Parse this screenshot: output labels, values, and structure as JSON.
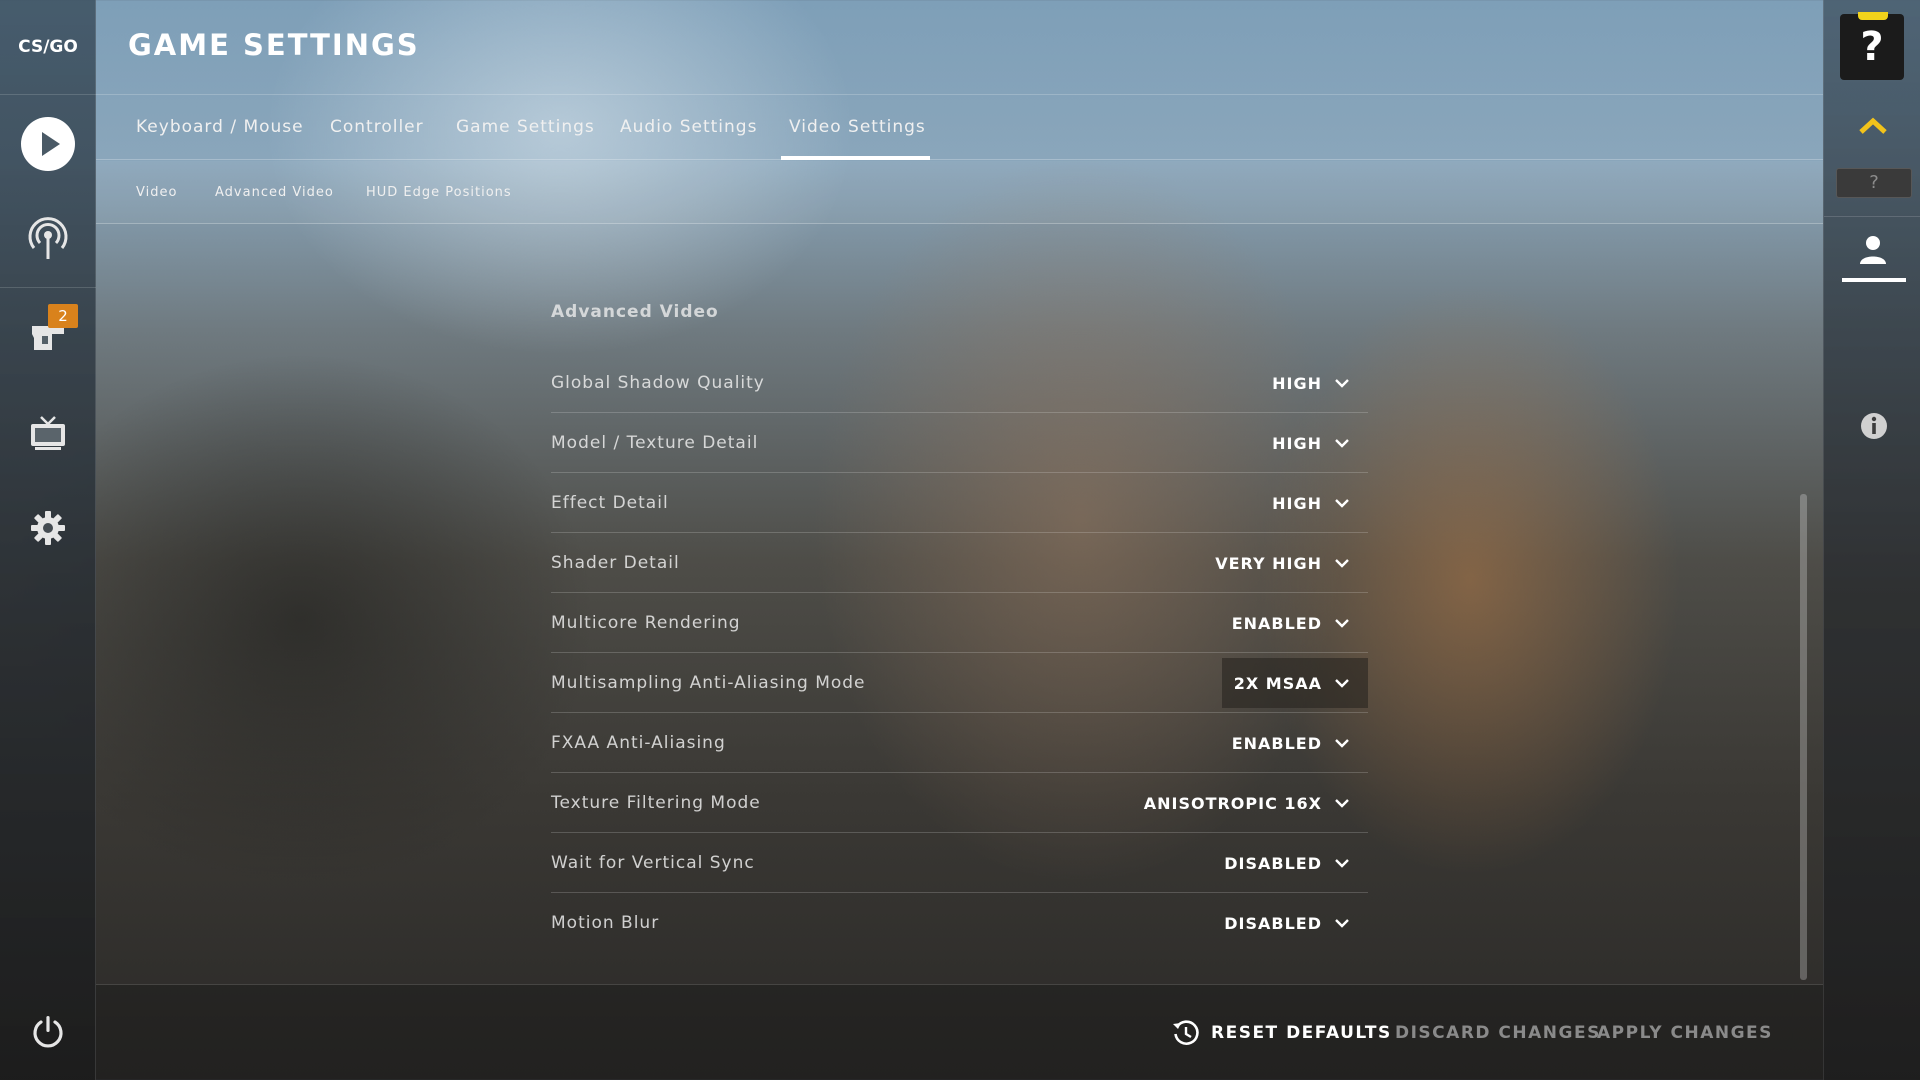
{
  "app": {
    "logo_text": "CS/GO"
  },
  "leftnav": {
    "items": [
      {
        "name": "play",
        "icon": "play-icon"
      },
      {
        "name": "watch",
        "icon": "broadcast-icon"
      },
      {
        "name": "inventory",
        "icon": "inventory-icon",
        "badge": "2"
      },
      {
        "name": "tv",
        "icon": "tv-icon"
      },
      {
        "name": "settings",
        "icon": "gear-icon"
      }
    ],
    "power_icon": "power-icon"
  },
  "header": {
    "title": "GAME SETTINGS"
  },
  "tabs": [
    {
      "label": "Keyboard / Mouse",
      "active": false
    },
    {
      "label": "Controller",
      "active": false
    },
    {
      "label": "Game Settings",
      "active": false
    },
    {
      "label": "Audio Settings",
      "active": false
    },
    {
      "label": "Video Settings",
      "active": true
    }
  ],
  "subtabs": [
    {
      "label": "Video"
    },
    {
      "label": "Advanced Video"
    },
    {
      "label": "HUD Edge Positions"
    }
  ],
  "section": {
    "title": "Advanced Video",
    "rows": [
      {
        "label": "Global Shadow Quality",
        "value": "HIGH"
      },
      {
        "label": "Model / Texture Detail",
        "value": "HIGH"
      },
      {
        "label": "Effect Detail",
        "value": "HIGH"
      },
      {
        "label": "Shader Detail",
        "value": "VERY HIGH"
      },
      {
        "label": "Multicore Rendering",
        "value": "ENABLED"
      },
      {
        "label": "Multisampling Anti-Aliasing Mode",
        "value": "2X MSAA",
        "highlight": true
      },
      {
        "label": "FXAA Anti-Aliasing",
        "value": "ENABLED"
      },
      {
        "label": "Texture Filtering Mode",
        "value": "ANISOTROPIC 16X"
      },
      {
        "label": "Wait for Vertical Sync",
        "value": "DISABLED"
      },
      {
        "label": "Motion Blur",
        "value": "DISABLED"
      }
    ]
  },
  "footer": {
    "reset_label": "RESET DEFAULTS",
    "discard_label": "DISCARD CHANGES",
    "apply_label": "APPLY CHANGES"
  },
  "rightbar": {
    "help_label": "?",
    "small_help_label": "?"
  },
  "colors": {
    "badge": "#d9821c",
    "help_accent": "#f2d31b",
    "rank_chevron": "#f2c31b",
    "disabled_text": "#8a8a8a"
  }
}
